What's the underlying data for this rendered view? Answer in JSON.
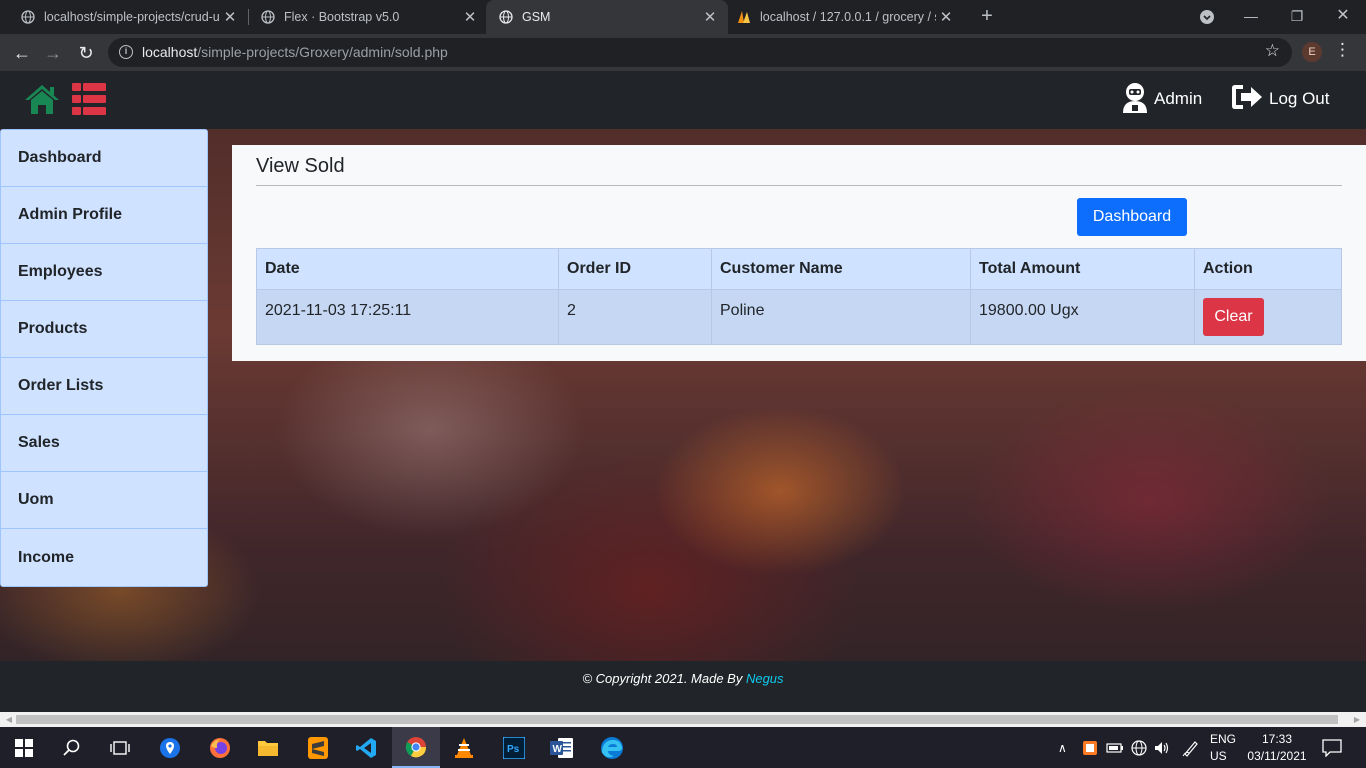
{
  "browser": {
    "tabs": [
      {
        "title": "localhost/simple-projects/crud-u",
        "active": false
      },
      {
        "title": "Flex · Bootstrap v5.0",
        "active": false
      },
      {
        "title": "GSM",
        "active": true
      },
      {
        "title": "localhost / 127.0.0.1 / grocery / s",
        "active": false
      }
    ],
    "url_host": "localhost",
    "url_path": "/simple-projects/Groxery/admin/sold.php",
    "profile_initial": "E"
  },
  "navbar": {
    "admin_label": "Admin",
    "logout_label": "Log Out",
    "home_icon_color": "#198754",
    "list_icon_color": "#dc3545"
  },
  "sidebar": {
    "items": [
      {
        "label": "Dashboard"
      },
      {
        "label": "Admin Profile"
      },
      {
        "label": "Employees"
      },
      {
        "label": "Products"
      },
      {
        "label": "Order Lists"
      },
      {
        "label": "Sales"
      },
      {
        "label": "Uom"
      },
      {
        "label": "Income"
      }
    ]
  },
  "main": {
    "title": "View Sold",
    "dashboard_button": "Dashboard",
    "table": {
      "columns": [
        "Date",
        "Order ID",
        "Customer Name",
        "Total Amount",
        "Action"
      ],
      "rows": [
        {
          "date": "2021-11-03 17:25:11",
          "order_id": "2",
          "customer": "Poline",
          "total": "19800.00 Ugx",
          "action": "Clear"
        }
      ]
    }
  },
  "footer": {
    "text": "© Copyright 2021. Made By ",
    "author": "Negus"
  },
  "taskbar": {
    "language_line1": "ENG",
    "language_line2": "US",
    "time": "17:33",
    "date": "03/11/2021"
  },
  "colors": {
    "primary": "#0d6efd",
    "danger": "#dc3545",
    "sidebar_bg": "#cfe2ff",
    "navbar_bg": "#212529"
  }
}
